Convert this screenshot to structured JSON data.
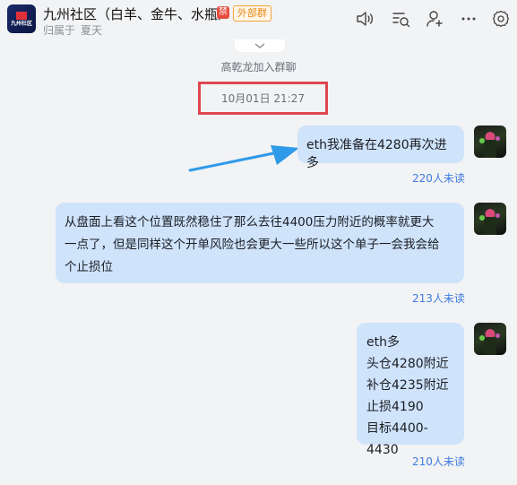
{
  "header": {
    "group_name": "九州社区（白羊、金牛、水瓶）",
    "badge_icon_text": "禁",
    "external_tag": "外部群",
    "subtitle_prefix": "归属于",
    "subtitle_owner": "夏天",
    "avatar_label": "九州社区"
  },
  "toolbar_icons": [
    "voice-icon",
    "chat-search-icon",
    "add-member-icon",
    "more-icon",
    "settings-icon"
  ],
  "system": {
    "join_notice": "高乾龙加入群聊",
    "timestamp": "10月01日 21:27"
  },
  "messages": [
    {
      "lines": [
        "eth我准备在4280再次进多"
      ],
      "read_count": "220人未读"
    },
    {
      "lines": [
        "从盘面上看这个位置既然稳住了那么去往4400压力附近的概率就更大",
        "一点了，但是同样这个开单风险也会更大一些所以这个单子一会我会给",
        "个止损位"
      ],
      "read_count": "213人未读"
    },
    {
      "lines": [
        "eth多",
        "头仓4280附近",
        "补仓4235附近",
        "止损4190",
        "目标4400-4430"
      ],
      "read_count": "210人未读"
    }
  ],
  "colors": {
    "bubble": "#cfe3fb",
    "read_status": "#3d7be0",
    "highlight_box": "#e0474f",
    "arrow": "#2f9ae8"
  }
}
